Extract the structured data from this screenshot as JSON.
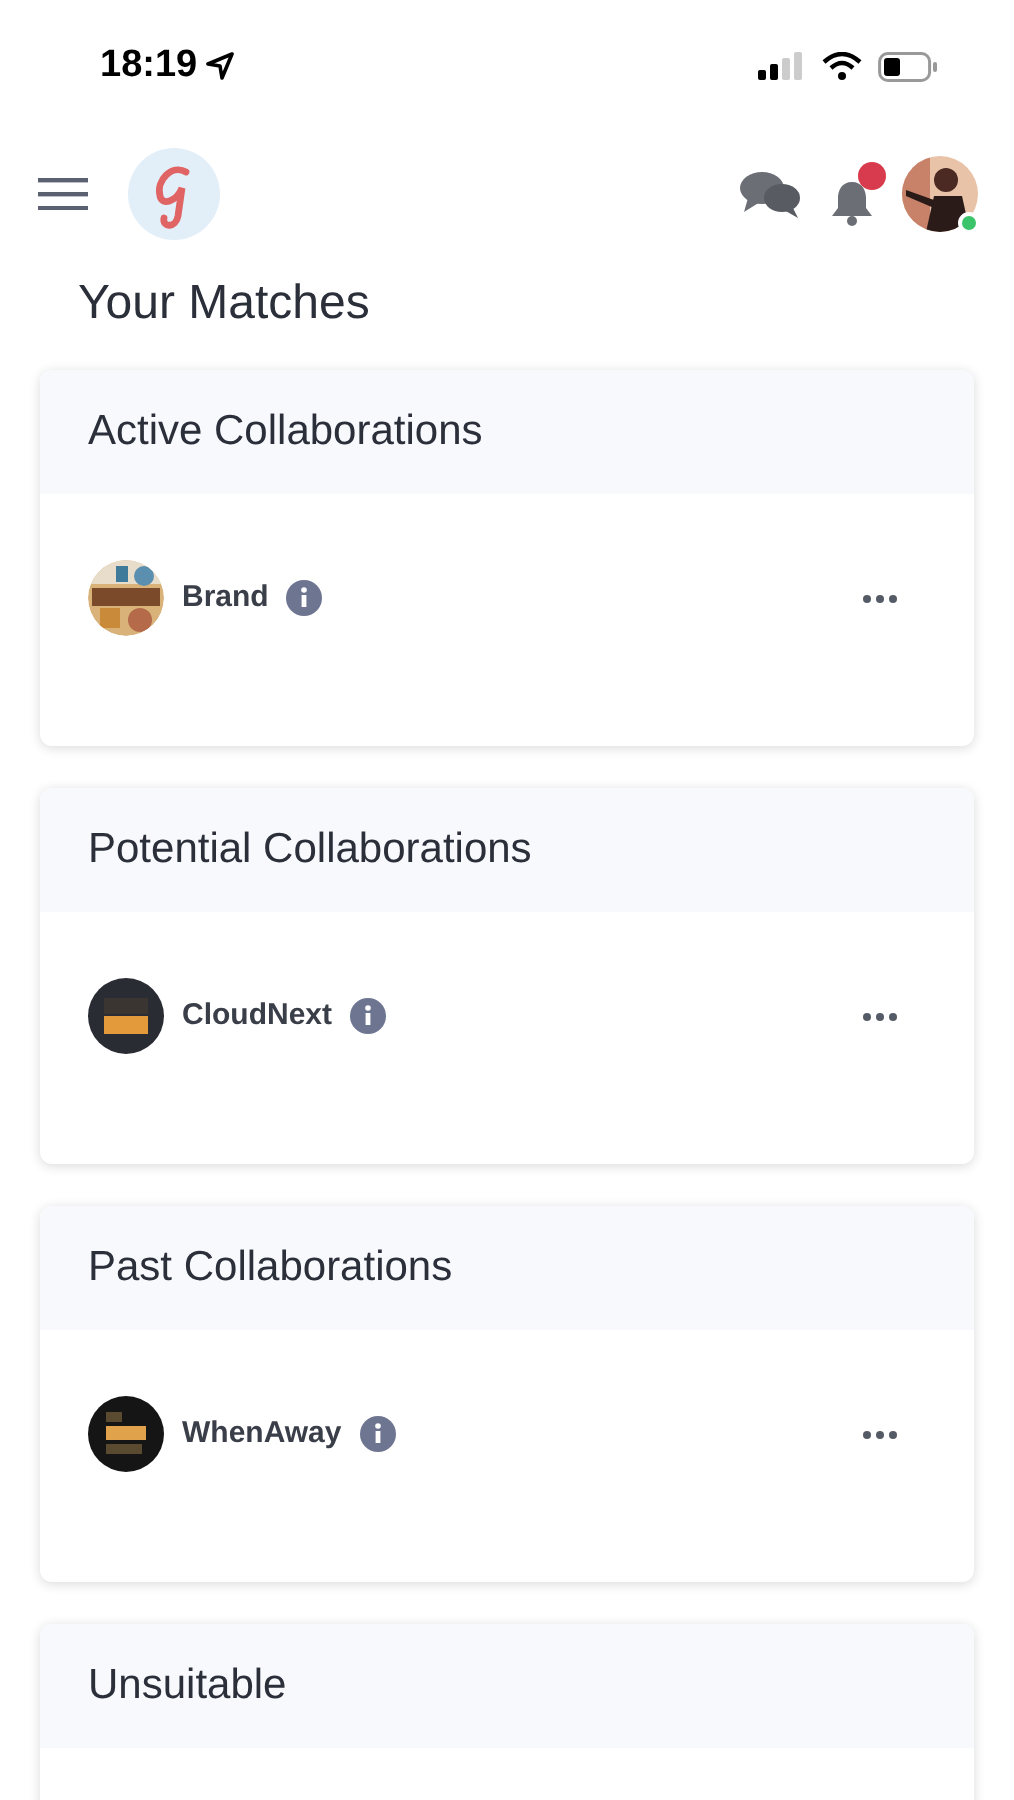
{
  "status_bar": {
    "time": "18:19"
  },
  "header": {
    "notification_dot": true,
    "online": true
  },
  "title": "Your Matches",
  "sections": [
    {
      "title": "Active Collaborations",
      "matches": [
        {
          "name": "Brand",
          "kind": "collage"
        }
      ]
    },
    {
      "title": "Potential Collaborations",
      "matches": [
        {
          "name": "CloudNext",
          "kind": "dark-badge"
        }
      ]
    },
    {
      "title": "Past Collaborations",
      "matches": [
        {
          "name": "WhenAway",
          "kind": "dark-stripe"
        }
      ]
    },
    {
      "title": "Unsuitable"
    }
  ]
}
